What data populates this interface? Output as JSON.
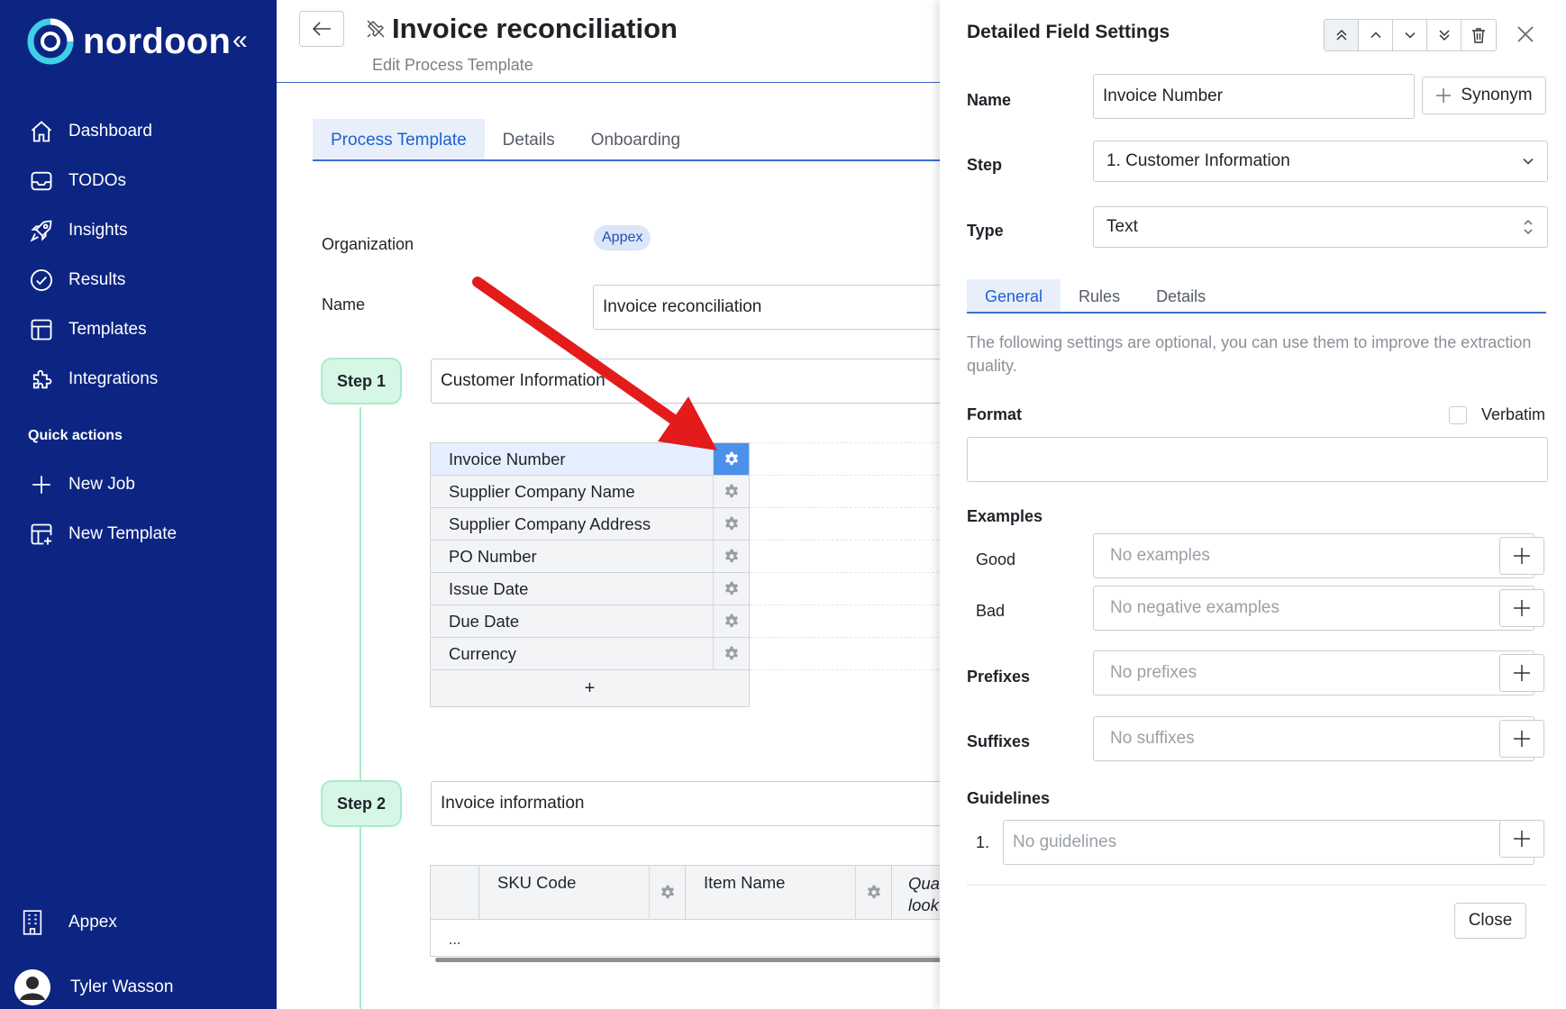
{
  "brand": {
    "name": "nordoon"
  },
  "sidebar": {
    "nav": [
      {
        "label": "Dashboard",
        "icon": "home-icon"
      },
      {
        "label": "TODOs",
        "icon": "inbox-icon"
      },
      {
        "label": "Insights",
        "icon": "rocket-icon"
      },
      {
        "label": "Results",
        "icon": "check-circle-icon"
      },
      {
        "label": "Templates",
        "icon": "layout-icon"
      },
      {
        "label": "Integrations",
        "icon": "puzzle-icon"
      }
    ],
    "quick_actions_title": "Quick actions",
    "quick_actions": [
      {
        "label": "New Job",
        "icon": "plus-icon"
      },
      {
        "label": "New Template",
        "icon": "layout-plus-icon"
      }
    ],
    "organization": "Appex",
    "user": "Tyler Wasson"
  },
  "header": {
    "title": "Invoice reconciliation",
    "subtitle": "Edit Process Template"
  },
  "tabs": [
    "Process Template",
    "Details",
    "Onboarding"
  ],
  "form": {
    "organization_label": "Organization",
    "organization_value": "Appex",
    "name_label": "Name",
    "name_value": "Invoice reconciliation"
  },
  "steps": [
    {
      "label": "Step 1",
      "name": "Customer Information",
      "fields": [
        "Invoice Number",
        "Supplier Company Name",
        "Supplier Company Address",
        "PO Number",
        "Issue Date",
        "Due Date",
        "Currency"
      ],
      "add_label": "+"
    },
    {
      "label": "Step 2",
      "name": "Invoice information",
      "columns": [
        "SKU Code",
        "Item Name"
      ],
      "truncated_column": "Qua\nlook",
      "row_placeholder": "..."
    }
  ],
  "panel": {
    "title": "Detailed Field Settings",
    "name_label": "Name",
    "name_value": "Invoice Number",
    "synonym_label": "Synonym",
    "step_label": "Step",
    "step_value": "1. Customer Information",
    "type_label": "Type",
    "type_value": "Text",
    "tabs": [
      "General",
      "Rules",
      "Details"
    ],
    "description": "The following settings are optional, you can use them to improve the extraction quality.",
    "format_label": "Format",
    "verbatim_label": "Verbatim",
    "format_value": "",
    "examples_label": "Examples",
    "good_label": "Good",
    "good_placeholder": "No examples",
    "bad_label": "Bad",
    "bad_placeholder": "No negative examples",
    "prefixes_label": "Prefixes",
    "prefixes_placeholder": "No prefixes",
    "suffixes_label": "Suffixes",
    "suffixes_placeholder": "No suffixes",
    "guidelines_label": "Guidelines",
    "guideline_number": "1.",
    "guidelines_placeholder": "No guidelines",
    "close_label": "Close"
  },
  "colors": {
    "sidebar_bg": "#0c2583",
    "accent": "#1f5fd1",
    "step_pill": "#d6f6e6",
    "annotation_arrow": "#e31b1b",
    "selected_gear": "#4b90ea"
  }
}
